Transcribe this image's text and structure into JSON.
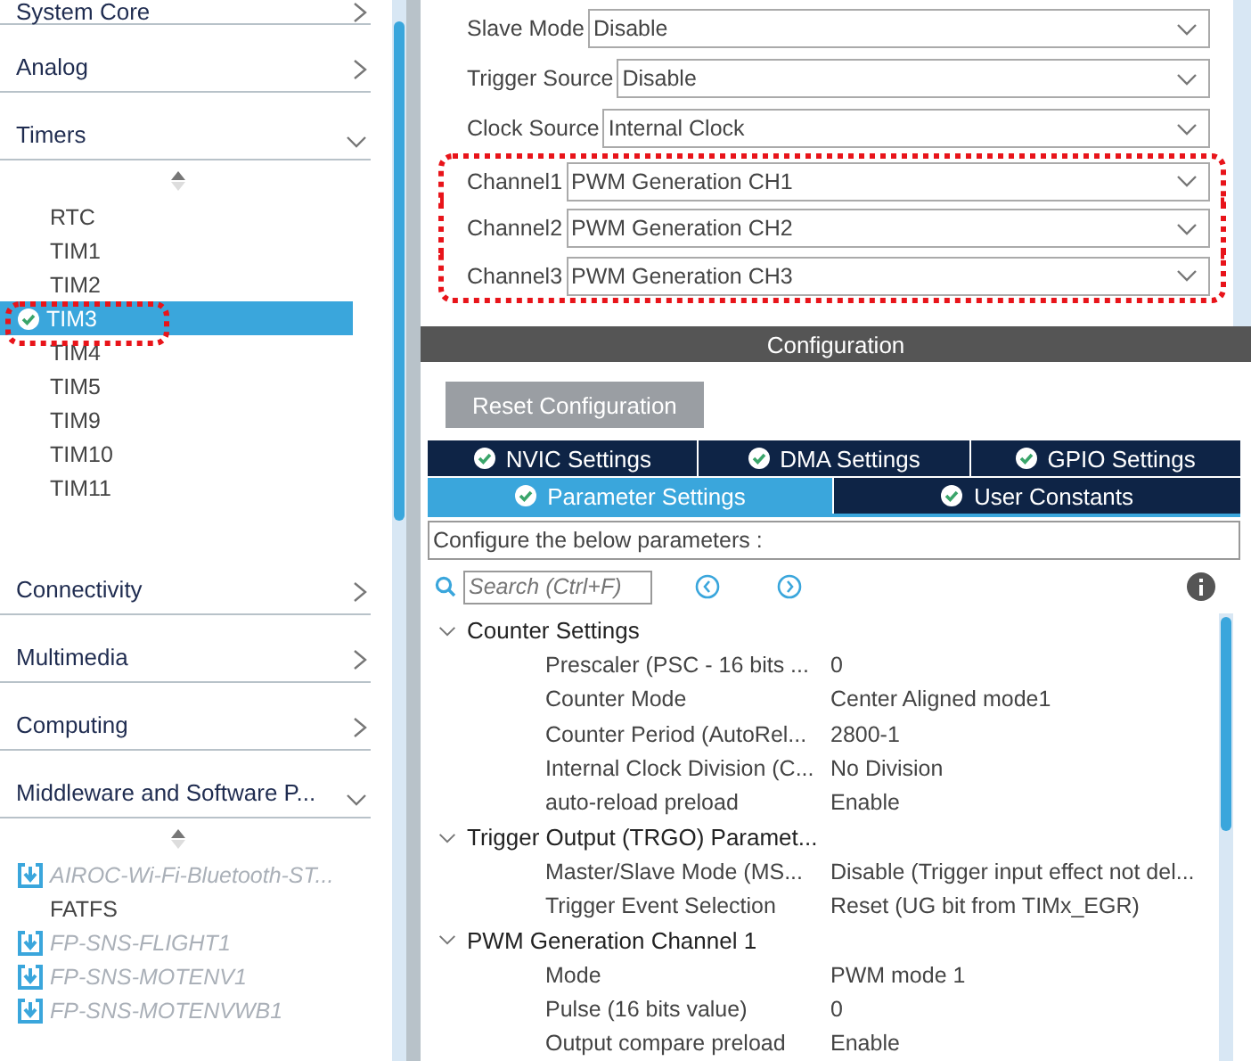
{
  "sidebar": {
    "categories": [
      {
        "label": "System Core",
        "expanded": false
      },
      {
        "label": "Analog",
        "expanded": false
      },
      {
        "label": "Timers",
        "expanded": true,
        "items": [
          {
            "label": "RTC",
            "selected": false,
            "configured": false,
            "kind": "plain"
          },
          {
            "label": "TIM1",
            "selected": false,
            "configured": false,
            "kind": "plain"
          },
          {
            "label": "TIM2",
            "selected": false,
            "configured": false,
            "kind": "plain"
          },
          {
            "label": "TIM3",
            "selected": true,
            "configured": true,
            "kind": "plain"
          },
          {
            "label": "TIM4",
            "selected": false,
            "configured": false,
            "kind": "plain"
          },
          {
            "label": "TIM5",
            "selected": false,
            "configured": false,
            "kind": "plain"
          },
          {
            "label": "TIM9",
            "selected": false,
            "configured": false,
            "kind": "plain"
          },
          {
            "label": "TIM10",
            "selected": false,
            "configured": false,
            "kind": "plain"
          },
          {
            "label": "TIM11",
            "selected": false,
            "configured": false,
            "kind": "plain"
          }
        ]
      },
      {
        "label": "Connectivity",
        "expanded": false
      },
      {
        "label": "Multimedia",
        "expanded": false
      },
      {
        "label": "Computing",
        "expanded": false
      },
      {
        "label": "Middleware and Software P...",
        "expanded": true,
        "items": [
          {
            "label": "AIROC-Wi-Fi-Bluetooth-ST...",
            "selected": false,
            "configured": false,
            "kind": "download"
          },
          {
            "label": "FATFS",
            "selected": false,
            "configured": false,
            "kind": "plain"
          },
          {
            "label": "FP-SNS-FLIGHT1",
            "selected": false,
            "configured": false,
            "kind": "download"
          },
          {
            "label": "FP-SNS-MOTENV1",
            "selected": false,
            "configured": false,
            "kind": "download"
          },
          {
            "label": "FP-SNS-MOTENVWB1",
            "selected": false,
            "configured": false,
            "kind": "download"
          }
        ]
      }
    ]
  },
  "mode_fields": [
    {
      "label": "Slave Mode",
      "value": "Disable",
      "highlighted": false
    },
    {
      "label": "Trigger Source",
      "value": "Disable",
      "highlighted": false
    },
    {
      "label": "Clock Source",
      "value": "Internal Clock",
      "highlighted": false
    },
    {
      "label": "Channel1",
      "value": "PWM Generation CH1",
      "highlighted": true
    },
    {
      "label": "Channel2",
      "value": "PWM Generation CH2",
      "highlighted": true
    },
    {
      "label": "Channel3",
      "value": "PWM Generation CH3",
      "highlighted": true
    }
  ],
  "configuration": {
    "title": "Configuration",
    "reset_button": "Reset Configuration",
    "tabs": [
      {
        "label": "NVIC Settings",
        "selected": false
      },
      {
        "label": "DMA Settings",
        "selected": false
      },
      {
        "label": "GPIO Settings",
        "selected": false
      },
      {
        "label": "Parameter Settings",
        "selected": true
      },
      {
        "label": "User Constants",
        "selected": false
      }
    ],
    "hint": "Configure the below parameters :",
    "search": {
      "placeholder": "Search (Ctrl+F)"
    },
    "groups": [
      {
        "label": "Counter Settings",
        "expanded": true,
        "children": [
          {
            "name": "Prescaler (PSC - 16 bits ...",
            "value": "0"
          },
          {
            "name": "Counter Mode",
            "value": "Center Aligned mode1"
          },
          {
            "name": "Counter Period (AutoRel...",
            "value": "2800-1"
          },
          {
            "name": "Internal Clock Division (C...",
            "value": "No Division"
          },
          {
            "name": "auto-reload preload",
            "value": "Enable"
          }
        ]
      },
      {
        "label": "Trigger Output (TRGO) Paramet...",
        "expanded": true,
        "children": [
          {
            "name": "Master/Slave Mode (MS...",
            "value": "Disable (Trigger input effect not del..."
          },
          {
            "name": "Trigger Event Selection",
            "value": "Reset (UG bit from TIMx_EGR)"
          }
        ]
      },
      {
        "label": "PWM Generation Channel 1",
        "expanded": true,
        "children": [
          {
            "name": "Mode",
            "value": "PWM mode 1"
          },
          {
            "name": "Pulse (16 bits value)",
            "value": "0"
          },
          {
            "name": "Output compare preload",
            "value": "Enable"
          }
        ]
      }
    ]
  }
}
